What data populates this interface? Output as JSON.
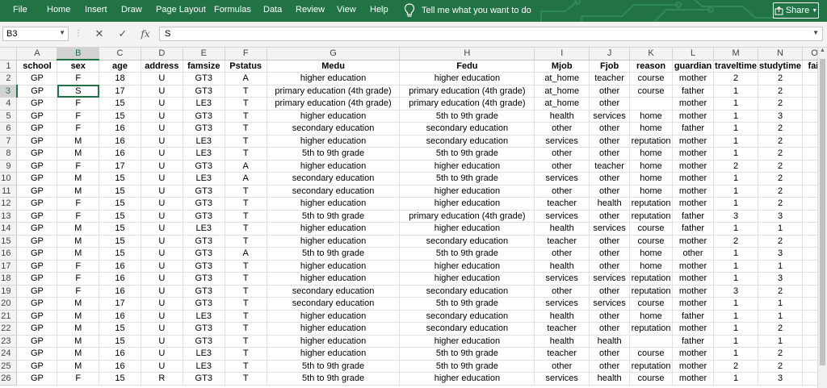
{
  "menu": {
    "items": [
      "File",
      "Home",
      "Insert",
      "Draw",
      "Page Layout",
      "Formulas",
      "Data",
      "Review",
      "View",
      "Help"
    ],
    "tell_me": "Tell me what you want to do",
    "share": "Share"
  },
  "formula_bar": {
    "name_box": "B3",
    "fx": "fx",
    "value": "S"
  },
  "colors": {
    "accent": "#217346",
    "header_bg": "#f3f3f3",
    "selected_header": "#d2d2d2"
  },
  "columns": [
    "A",
    "B",
    "C",
    "D",
    "E",
    "F",
    "G",
    "H",
    "I",
    "J",
    "K",
    "L",
    "M",
    "N",
    "O"
  ],
  "column_widths": [],
  "header_row": [
    "school",
    "sex",
    "age",
    "address",
    "famsize",
    "Pstatus",
    "Medu",
    "Fedu",
    "Mjob",
    "Fjob",
    "reason",
    "guardian",
    "traveltime",
    "studytime",
    "fail"
  ],
  "rows": [
    [
      "GP",
      "F",
      "18",
      "U",
      "GT3",
      "A",
      "higher education",
      "higher education",
      "at_home",
      "teacher",
      "course",
      "mother",
      "2",
      "2",
      ""
    ],
    [
      "GP",
      "S",
      "17",
      "U",
      "GT3",
      "T",
      "primary education (4th grade)",
      "primary education (4th grade)",
      "at_home",
      "other",
      "course",
      "father",
      "1",
      "2",
      ""
    ],
    [
      "GP",
      "F",
      "15",
      "U",
      "LE3",
      "T",
      "primary education (4th grade)",
      "primary education (4th grade)",
      "at_home",
      "other",
      "",
      "mother",
      "1",
      "2",
      ""
    ],
    [
      "GP",
      "F",
      "15",
      "U",
      "GT3",
      "T",
      "higher education",
      "5th to 9th grade",
      "health",
      "services",
      "home",
      "mother",
      "1",
      "3",
      ""
    ],
    [
      "GP",
      "F",
      "16",
      "U",
      "GT3",
      "T",
      "secondary education",
      "secondary education",
      "other",
      "other",
      "home",
      "father",
      "1",
      "2",
      ""
    ],
    [
      "GP",
      "M",
      "16",
      "U",
      "LE3",
      "T",
      "higher education",
      "secondary education",
      "services",
      "other",
      "reputation",
      "mother",
      "1",
      "2",
      ""
    ],
    [
      "GP",
      "M",
      "16",
      "U",
      "LE3",
      "T",
      "5th to 9th grade",
      "5th to 9th grade",
      "other",
      "other",
      "home",
      "mother",
      "1",
      "2",
      ""
    ],
    [
      "GP",
      "F",
      "17",
      "U",
      "GT3",
      "A",
      "higher education",
      "higher education",
      "other",
      "teacher",
      "home",
      "mother",
      "2",
      "2",
      ""
    ],
    [
      "GP",
      "M",
      "15",
      "U",
      "LE3",
      "A",
      "secondary education",
      "5th to 9th grade",
      "services",
      "other",
      "home",
      "mother",
      "1",
      "2",
      ""
    ],
    [
      "GP",
      "M",
      "15",
      "U",
      "GT3",
      "T",
      "secondary education",
      "higher education",
      "other",
      "other",
      "home",
      "mother",
      "1",
      "2",
      ""
    ],
    [
      "GP",
      "F",
      "15",
      "U",
      "GT3",
      "T",
      "higher education",
      "higher education",
      "teacher",
      "health",
      "reputation",
      "mother",
      "1",
      "2",
      ""
    ],
    [
      "GP",
      "F",
      "15",
      "U",
      "GT3",
      "T",
      "5th to 9th grade",
      "primary education (4th grade)",
      "services",
      "other",
      "reputation",
      "father",
      "3",
      "3",
      ""
    ],
    [
      "GP",
      "M",
      "15",
      "U",
      "LE3",
      "T",
      "higher education",
      "higher education",
      "health",
      "services",
      "course",
      "father",
      "1",
      "1",
      ""
    ],
    [
      "GP",
      "M",
      "15",
      "U",
      "GT3",
      "T",
      "higher education",
      "secondary education",
      "teacher",
      "other",
      "course",
      "mother",
      "2",
      "2",
      ""
    ],
    [
      "GP",
      "M",
      "15",
      "U",
      "GT3",
      "A",
      "5th to 9th grade",
      "5th to 9th grade",
      "other",
      "other",
      "home",
      "other",
      "1",
      "3",
      ""
    ],
    [
      "GP",
      "F",
      "16",
      "U",
      "GT3",
      "T",
      "higher education",
      "higher education",
      "health",
      "other",
      "home",
      "mother",
      "1",
      "1",
      ""
    ],
    [
      "GP",
      "F",
      "16",
      "U",
      "GT3",
      "T",
      "higher education",
      "higher education",
      "services",
      "services",
      "reputation",
      "mother",
      "1",
      "3",
      ""
    ],
    [
      "GP",
      "F",
      "16",
      "U",
      "GT3",
      "T",
      "secondary education",
      "secondary education",
      "other",
      "other",
      "reputation",
      "mother",
      "3",
      "2",
      ""
    ],
    [
      "GP",
      "M",
      "17",
      "U",
      "GT3",
      "T",
      "secondary education",
      "5th to 9th grade",
      "services",
      "services",
      "course",
      "mother",
      "1",
      "1",
      ""
    ],
    [
      "GP",
      "M",
      "16",
      "U",
      "LE3",
      "T",
      "higher education",
      "secondary education",
      "health",
      "other",
      "home",
      "father",
      "1",
      "1",
      ""
    ],
    [
      "GP",
      "M",
      "15",
      "U",
      "GT3",
      "T",
      "higher education",
      "secondary education",
      "teacher",
      "other",
      "reputation",
      "mother",
      "1",
      "2",
      ""
    ],
    [
      "GP",
      "M",
      "15",
      "U",
      "GT3",
      "T",
      "higher education",
      "higher education",
      "health",
      "health",
      "",
      "father",
      "1",
      "1",
      ""
    ],
    [
      "GP",
      "M",
      "16",
      "U",
      "LE3",
      "T",
      "higher education",
      "5th to 9th grade",
      "teacher",
      "other",
      "course",
      "mother",
      "1",
      "2",
      ""
    ],
    [
      "GP",
      "M",
      "16",
      "U",
      "LE3",
      "T",
      "5th to 9th grade",
      "5th to 9th grade",
      "other",
      "other",
      "reputation",
      "mother",
      "2",
      "2",
      ""
    ],
    [
      "GP",
      "F",
      "15",
      "R",
      "GT3",
      "T",
      "5th to 9th grade",
      "higher education",
      "services",
      "health",
      "course",
      "mother",
      "1",
      "3",
      ""
    ]
  ]
}
